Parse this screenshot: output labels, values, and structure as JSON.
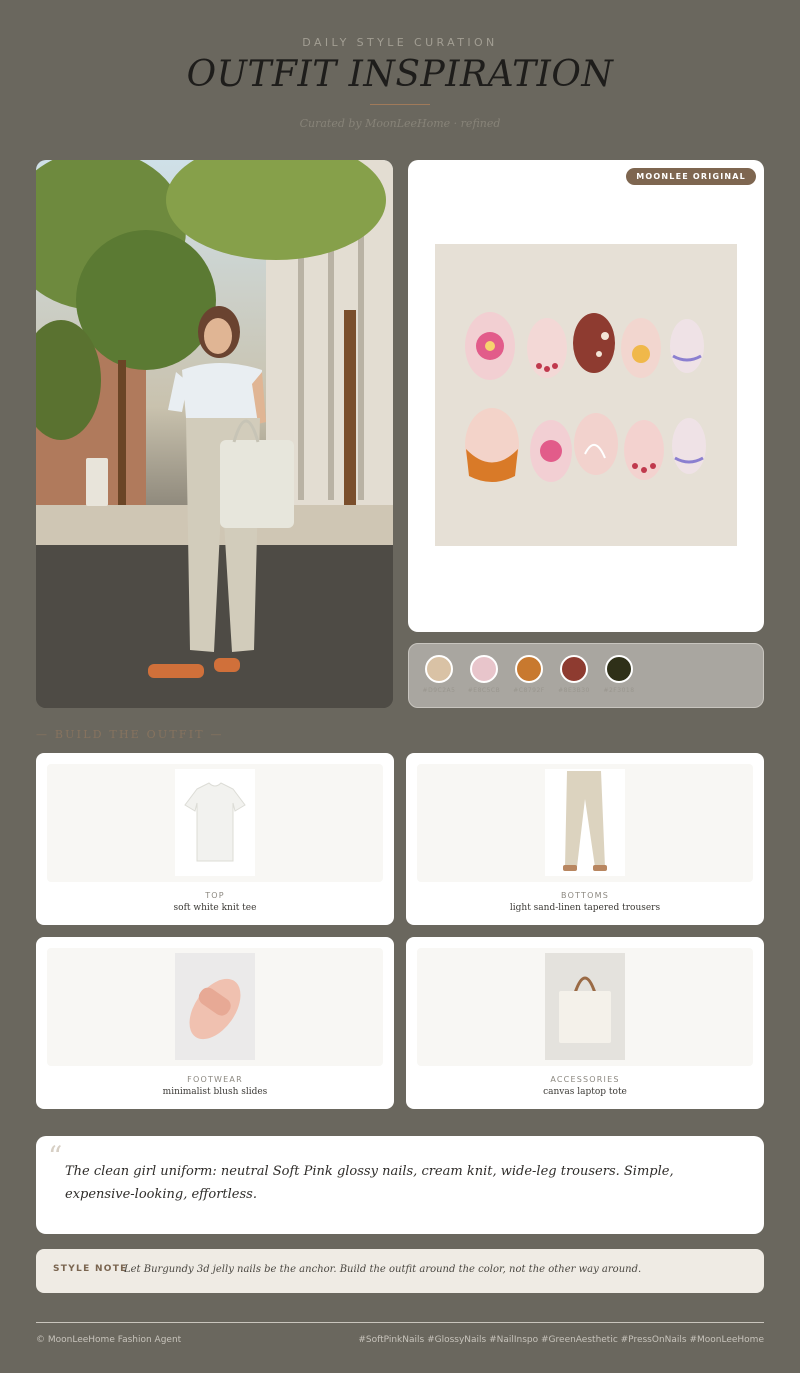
{
  "header": {
    "kicker": "DAILY STYLE CURATION",
    "title": "OUTFIT INSPIRATION",
    "curated": "Curated by MoonLeeHome · refined"
  },
  "nails": {
    "badge": "MOONLEE ORIGINAL"
  },
  "palette": {
    "swatches": [
      {
        "color": "#D9C2A5",
        "label": "#D9C2A5"
      },
      {
        "color": "#E8C5CB",
        "label": "#E8C5CB"
      },
      {
        "color": "#C8792F",
        "label": "#C8792F"
      },
      {
        "color": "#8E3B30",
        "label": "#8E3B30"
      },
      {
        "color": "#2F3018",
        "label": "#2F3018"
      }
    ]
  },
  "build": {
    "label": "— BUILD THE OUTFIT —",
    "pieces": [
      {
        "category": "TOP",
        "description": "soft white knit tee"
      },
      {
        "category": "BOTTOMS",
        "description": "light sand-linen tapered trousers"
      },
      {
        "category": "FOOTWEAR",
        "description": "minimalist blush slides"
      },
      {
        "category": "ACCESSORIES",
        "description": "canvas laptop tote"
      }
    ]
  },
  "quote": {
    "mark": "“",
    "text": "The clean girl uniform: neutral Soft Pink glossy nails, cream knit, wide-leg trousers. Simple, expensive-looking, effortless."
  },
  "style_note": {
    "label": "STYLE NOTE",
    "text": "Let Burgundy 3d jelly nails be the anchor. Build the outfit around the color, not the other way around."
  },
  "footer": {
    "left": "© MoonLeeHome Fashion Agent",
    "right": "#SoftPinkNails #GlossyNails #NailInspo #GreenAesthetic #PressOnNails #MoonLeeHome"
  }
}
